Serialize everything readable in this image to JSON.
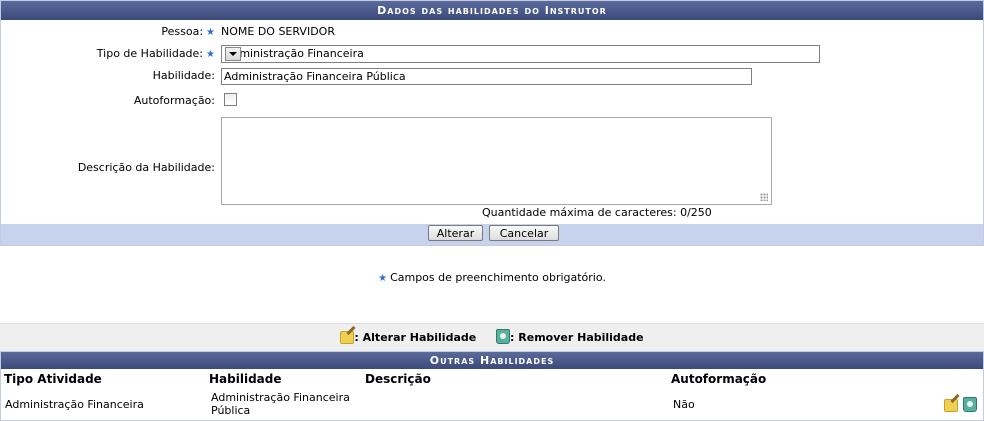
{
  "form": {
    "caption": "Dados das habilidades do Instrutor",
    "pessoa_label": "Pessoa:",
    "pessoa_value": "NOME DO SERVIDOR",
    "tipo_label": "Tipo de Habilidade:",
    "tipo_value": "Administração Financeira",
    "habilidade_label": "Habilidade:",
    "habilidade_value": "Administração Financeira Pública",
    "autoformacao_label": "Autoformação:",
    "autoformacao_checked": false,
    "descricao_label": "Descrição da Habilidade:",
    "descricao_value": "",
    "counter": "Quantidade máxima de caracteres: 0/250",
    "alterar_button": "Alterar",
    "cancelar_button": "Cancelar",
    "required_star": "★",
    "required_note": "Campos de preenchimento obrigatório."
  },
  "legend": {
    "alterar": ": Alterar Habilidade",
    "remover": ": Remover Habilidade",
    "edit_icon": "edit-icon",
    "remove_icon": "trash-icon"
  },
  "list": {
    "caption": "Outras Habilidades",
    "columns": [
      "Tipo Atividade",
      "Habilidade",
      "Descrição",
      "Autoformação"
    ],
    "rows": [
      {
        "tipo": "Administração Financeira",
        "habilidade_line1": "Administração Financeira",
        "habilidade_line2": "Pública",
        "descricao": "",
        "autoformacao": "Não"
      }
    ]
  },
  "colors": {
    "caption_bg": "#3c4a7a",
    "button_bar": "#c7d3ec",
    "required_star": "#2f6fc8"
  }
}
